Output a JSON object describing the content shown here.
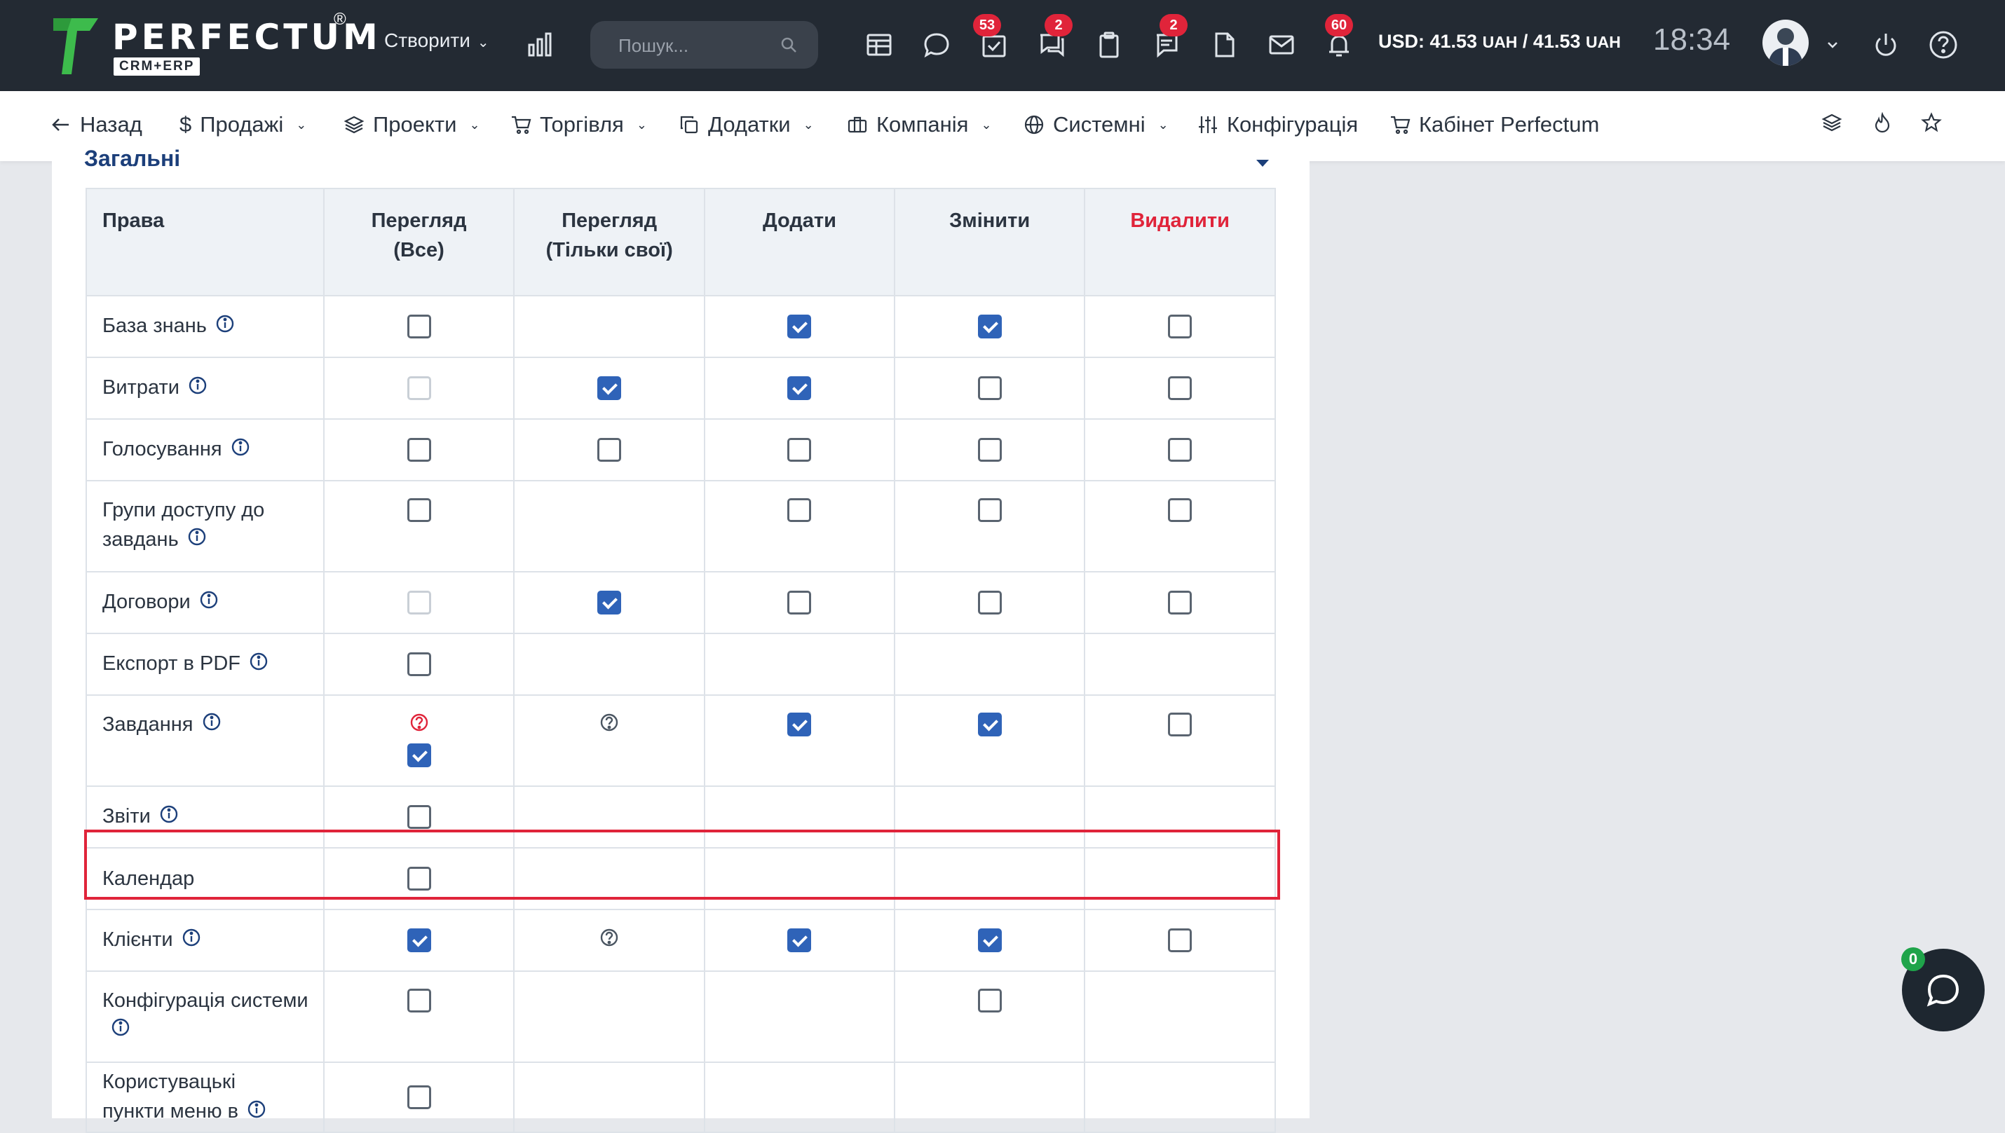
{
  "brand": {
    "name": "PERFECTUM",
    "reg": "®",
    "sub": "CRM+ERP",
    "colors": {
      "green": "#3dbb4c",
      "dark": "#232a33"
    }
  },
  "topbar": {
    "create_label": "Створити",
    "search_placeholder": "Пошук...",
    "badges": {
      "tasks": "53",
      "discussions": "2",
      "notes": "2",
      "notifications": "60"
    },
    "currency": {
      "prefix": "USD: 41.53 ",
      "u1": "UAH",
      "mid": " / 41.53 ",
      "u2": "UAH"
    },
    "clock": "18:34"
  },
  "nav": {
    "back": "Назад",
    "sales": "Продажі",
    "projects": "Проекти",
    "trade": "Торгівля",
    "addons": "Додатки",
    "company": "Компанія",
    "system": "Системні",
    "config": "Конфігурація",
    "cabinet": "Кабінет Perfectum"
  },
  "panel": {
    "title": "Загальні"
  },
  "table": {
    "headers": {
      "rights": "Права",
      "view_all_1": "Перегляд",
      "view_all_2": "(Все)",
      "view_own_1": "Перегляд",
      "view_own_2": "(Тільки свої)",
      "add": "Додати",
      "edit": "Змінити",
      "delete": "Видалити"
    },
    "rows": [
      {
        "name": "База знань",
        "info": true
      },
      {
        "name": "Витрати",
        "info": true
      },
      {
        "name": "Голосування",
        "info": true
      },
      {
        "name_1": "Групи доступу до",
        "name_2": "завдань",
        "info": true
      },
      {
        "name": "Договори",
        "info": true
      },
      {
        "name": "Експорт в PDF",
        "info": true
      },
      {
        "name": "Завдання",
        "info": true
      },
      {
        "name": "Звіти",
        "info": true
      },
      {
        "name": "Календар",
        "info": false
      },
      {
        "name": "Клієнти",
        "info": true
      },
      {
        "name_1": "Конфігурація системи",
        "info": true
      },
      {
        "name_1": "Користувацькі",
        "name_2": "пункти меню в",
        "info": true
      }
    ],
    "states": [
      [
        "unchecked",
        "none",
        "checked",
        "checked",
        "unchecked"
      ],
      [
        "disabled",
        "checked",
        "checked",
        "unchecked",
        "unchecked"
      ],
      [
        "unchecked",
        "unchecked",
        "unchecked",
        "unchecked",
        "unchecked"
      ],
      [
        "unchecked",
        "none",
        "unchecked",
        "unchecked",
        "unchecked"
      ],
      [
        "disabled",
        "checked",
        "unchecked",
        "unchecked",
        "unchecked"
      ],
      [
        "unchecked",
        "none",
        "none",
        "none",
        "none"
      ],
      [
        "help-red+checked",
        "help",
        "checked",
        "checked",
        "unchecked"
      ],
      [
        "unchecked",
        "none",
        "none",
        "none",
        "none"
      ],
      [
        "unchecked",
        "none",
        "none",
        "none",
        "none"
      ],
      [
        "checked",
        "help",
        "checked",
        "checked",
        "unchecked"
      ],
      [
        "unchecked",
        "none",
        "none",
        "unchecked",
        "none"
      ],
      [
        "unchecked",
        "none",
        "none",
        "none",
        "none"
      ]
    ],
    "highlight_row": "Календар",
    "highlight_color": "#e0243a",
    "check_color": "#2f63b8"
  },
  "chat": {
    "badge": "0"
  }
}
